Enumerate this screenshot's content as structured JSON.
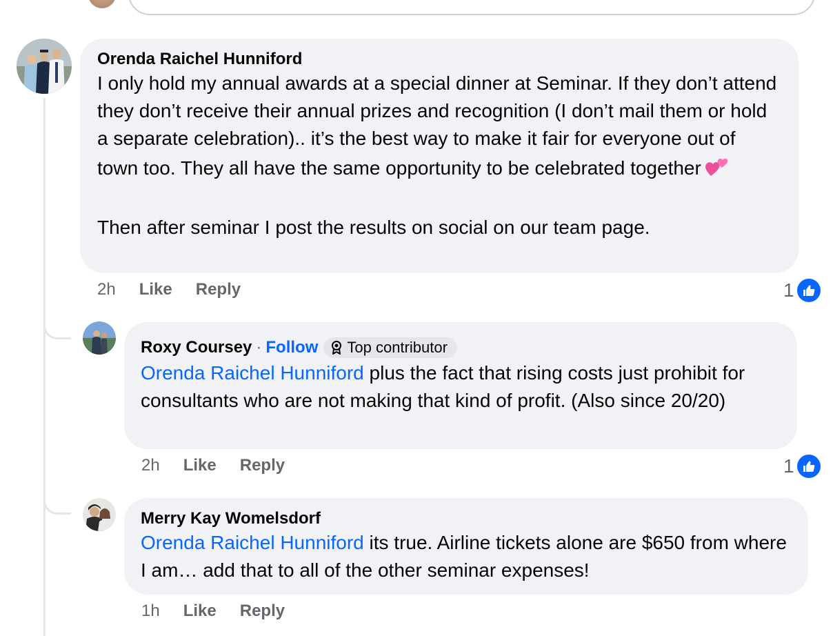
{
  "comments": [
    {
      "author": "Orenda Raichel Hunniford",
      "text": "I only hold my annual awards at a special dinner at Seminar. If they don’t attend they don’t receive their annual prizes and recognition (I don’t mail them or hold a separate celebration).. it’s the best way to make it fair for everyone out of town too. They all have the same opportunity to be celebrated together",
      "text_after_emoji": "\n\nThen after seminar I post the results on social on our team page.",
      "emoji": "two-hearts-icon",
      "time": "2h",
      "like_label": "Like",
      "reply_label": "Reply",
      "reaction_count": "1"
    },
    {
      "author": "Roxy Coursey",
      "separator": "·",
      "follow_label": "Follow",
      "badge_label": "Top contributor",
      "mention": "Orenda Raichel Hunniford",
      "text": " plus the fact that rising costs just prohibit for consultants who are not making that kind of profit. (Also since 20/20)",
      "time": "2h",
      "like_label": "Like",
      "reply_label": "Reply",
      "reaction_count": "1"
    },
    {
      "author": "Merry Kay Womelsdorf",
      "mention": "Orenda Raichel Hunniford",
      "text": " its true. Airline tickets alone are $650 from where I am… add that to all of the other seminar expenses!",
      "time": "1h",
      "like_label": "Like",
      "reply_label": "Reply"
    }
  ],
  "colors": {
    "bubble": "#f0f2f5",
    "link": "#0866ff",
    "secondary_text": "#65676b",
    "like_badge": "#0866ff"
  }
}
